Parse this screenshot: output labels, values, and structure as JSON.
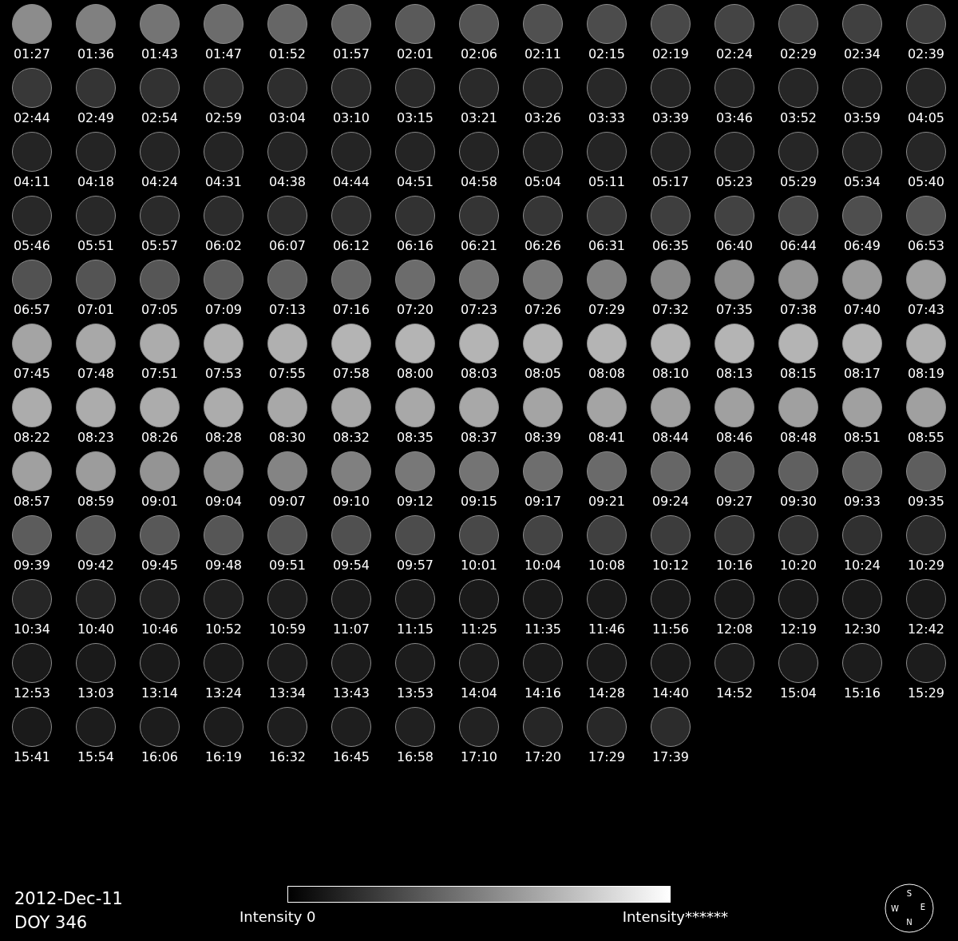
{
  "frames": [
    {
      "time": "01:27",
      "color": "#8c8c8c"
    },
    {
      "time": "01:36",
      "color": "#808080"
    },
    {
      "time": "01:43",
      "color": "#747474"
    },
    {
      "time": "01:47",
      "color": "#6c6c6c"
    },
    {
      "time": "01:52",
      "color": "#666666"
    },
    {
      "time": "01:57",
      "color": "#606060"
    },
    {
      "time": "02:01",
      "color": "#5a5a5a"
    },
    {
      "time": "02:06",
      "color": "#545454"
    },
    {
      "time": "02:11",
      "color": "#505050"
    },
    {
      "time": "02:15",
      "color": "#4c4c4c"
    },
    {
      "time": "02:19",
      "color": "#484848"
    },
    {
      "time": "02:24",
      "color": "#444444"
    },
    {
      "time": "02:29",
      "color": "#424242"
    },
    {
      "time": "02:34",
      "color": "#404040"
    },
    {
      "time": "02:39",
      "color": "#3e3e3e"
    },
    {
      "time": "02:44",
      "color": "#383838"
    },
    {
      "time": "02:49",
      "color": "#343434"
    },
    {
      "time": "02:54",
      "color": "#323232"
    },
    {
      "time": "02:59",
      "color": "#303030"
    },
    {
      "time": "03:04",
      "color": "#2e2e2e"
    },
    {
      "time": "03:10",
      "color": "#2c2c2c"
    },
    {
      "time": "03:15",
      "color": "#2a2a2a"
    },
    {
      "time": "03:21",
      "color": "#2a2a2a"
    },
    {
      "time": "03:26",
      "color": "#282828"
    },
    {
      "time": "03:33",
      "color": "#282828"
    },
    {
      "time": "03:39",
      "color": "#262626"
    },
    {
      "time": "03:46",
      "color": "#262626"
    },
    {
      "time": "03:52",
      "color": "#262626"
    },
    {
      "time": "03:59",
      "color": "#262626"
    },
    {
      "time": "04:05",
      "color": "#262626"
    },
    {
      "time": "04:11",
      "color": "#242424"
    },
    {
      "time": "04:18",
      "color": "#242424"
    },
    {
      "time": "04:24",
      "color": "#242424"
    },
    {
      "time": "04:31",
      "color": "#242424"
    },
    {
      "time": "04:38",
      "color": "#242424"
    },
    {
      "time": "04:44",
      "color": "#242424"
    },
    {
      "time": "04:51",
      "color": "#242424"
    },
    {
      "time": "04:58",
      "color": "#242424"
    },
    {
      "time": "05:04",
      "color": "#242424"
    },
    {
      "time": "05:11",
      "color": "#242424"
    },
    {
      "time": "05:17",
      "color": "#242424"
    },
    {
      "time": "05:23",
      "color": "#242424"
    },
    {
      "time": "05:29",
      "color": "#262626"
    },
    {
      "time": "05:34",
      "color": "#262626"
    },
    {
      "time": "05:40",
      "color": "#262626"
    },
    {
      "time": "05:46",
      "color": "#282828"
    },
    {
      "time": "05:51",
      "color": "#282828"
    },
    {
      "time": "05:57",
      "color": "#2a2a2a"
    },
    {
      "time": "06:02",
      "color": "#2c2c2c"
    },
    {
      "time": "06:07",
      "color": "#2e2e2e"
    },
    {
      "time": "06:12",
      "color": "#303030"
    },
    {
      "time": "06:16",
      "color": "#323232"
    },
    {
      "time": "06:21",
      "color": "#343434"
    },
    {
      "time": "06:26",
      "color": "#363636"
    },
    {
      "time": "06:31",
      "color": "#3a3a3a"
    },
    {
      "time": "06:35",
      "color": "#3e3e3e"
    },
    {
      "time": "06:40",
      "color": "#424242"
    },
    {
      "time": "06:44",
      "color": "#484848"
    },
    {
      "time": "06:49",
      "color": "#4e4e4e"
    },
    {
      "time": "06:53",
      "color": "#545454"
    },
    {
      "time": "06:57",
      "color": "#525252"
    },
    {
      "time": "07:01",
      "color": "#545454"
    },
    {
      "time": "07:05",
      "color": "#565656"
    },
    {
      "time": "07:09",
      "color": "#5c5c5c"
    },
    {
      "time": "07:13",
      "color": "#606060"
    },
    {
      "time": "07:16",
      "color": "#666666"
    },
    {
      "time": "07:20",
      "color": "#6c6c6c"
    },
    {
      "time": "07:23",
      "color": "#727272"
    },
    {
      "time": "07:26",
      "color": "#787878"
    },
    {
      "time": "07:29",
      "color": "#808080"
    },
    {
      "time": "07:32",
      "color": "#888888"
    },
    {
      "time": "07:35",
      "color": "#8e8e8e"
    },
    {
      "time": "07:38",
      "color": "#949494"
    },
    {
      "time": "07:40",
      "color": "#9a9a9a"
    },
    {
      "time": "07:43",
      "color": "#a0a0a0"
    },
    {
      "time": "07:45",
      "color": "#a4a4a4"
    },
    {
      "time": "07:48",
      "color": "#a8a8a8"
    },
    {
      "time": "07:51",
      "color": "#acacac"
    },
    {
      "time": "07:53",
      "color": "#b0b0b0"
    },
    {
      "time": "07:55",
      "color": "#b0b0b0"
    },
    {
      "time": "07:58",
      "color": "#b4b4b4"
    },
    {
      "time": "08:00",
      "color": "#b4b4b4"
    },
    {
      "time": "08:03",
      "color": "#b4b4b4"
    },
    {
      "time": "08:05",
      "color": "#b4b4b4"
    },
    {
      "time": "08:08",
      "color": "#b4b4b4"
    },
    {
      "time": "08:10",
      "color": "#b4b4b4"
    },
    {
      "time": "08:13",
      "color": "#b4b4b4"
    },
    {
      "time": "08:15",
      "color": "#b4b4b4"
    },
    {
      "time": "08:17",
      "color": "#b4b4b4"
    },
    {
      "time": "08:19",
      "color": "#b0b0b0"
    },
    {
      "time": "08:22",
      "color": "#acacac"
    },
    {
      "time": "08:23",
      "color": "#acacac"
    },
    {
      "time": "08:26",
      "color": "#acacac"
    },
    {
      "time": "08:28",
      "color": "#acacac"
    },
    {
      "time": "08:30",
      "color": "#a8a8a8"
    },
    {
      "time": "08:32",
      "color": "#a8a8a8"
    },
    {
      "time": "08:35",
      "color": "#a8a8a8"
    },
    {
      "time": "08:37",
      "color": "#a8a8a8"
    },
    {
      "time": "08:39",
      "color": "#a4a4a4"
    },
    {
      "time": "08:41",
      "color": "#a4a4a4"
    },
    {
      "time": "08:44",
      "color": "#a0a0a0"
    },
    {
      "time": "08:46",
      "color": "#a0a0a0"
    },
    {
      "time": "08:48",
      "color": "#a0a0a0"
    },
    {
      "time": "08:51",
      "color": "#a0a0a0"
    },
    {
      "time": "08:55",
      "color": "#a0a0a0"
    },
    {
      "time": "08:57",
      "color": "#a0a0a0"
    },
    {
      "time": "08:59",
      "color": "#9c9c9c"
    },
    {
      "time": "09:01",
      "color": "#949494"
    },
    {
      "time": "09:04",
      "color": "#8c8c8c"
    },
    {
      "time": "09:07",
      "color": "#848484"
    },
    {
      "time": "09:10",
      "color": "#808080"
    },
    {
      "time": "09:12",
      "color": "#787878"
    },
    {
      "time": "09:15",
      "color": "#747474"
    },
    {
      "time": "09:17",
      "color": "#6e6e6e"
    },
    {
      "time": "09:21",
      "color": "#6a6a6a"
    },
    {
      "time": "09:24",
      "color": "#666666"
    },
    {
      "time": "09:27",
      "color": "#626262"
    },
    {
      "time": "09:30",
      "color": "#606060"
    },
    {
      "time": "09:33",
      "color": "#5e5e5e"
    },
    {
      "time": "09:35",
      "color": "#5e5e5e"
    },
    {
      "time": "09:39",
      "color": "#5c5c5c"
    },
    {
      "time": "09:42",
      "color": "#5a5a5a"
    },
    {
      "time": "09:45",
      "color": "#585858"
    },
    {
      "time": "09:48",
      "color": "#565656"
    },
    {
      "time": "09:51",
      "color": "#545454"
    },
    {
      "time": "09:54",
      "color": "#505050"
    },
    {
      "time": "09:57",
      "color": "#4c4c4c"
    },
    {
      "time": "10:01",
      "color": "#484848"
    },
    {
      "time": "10:04",
      "color": "#444444"
    },
    {
      "time": "10:08",
      "color": "#404040"
    },
    {
      "time": "10:12",
      "color": "#3c3c3c"
    },
    {
      "time": "10:16",
      "color": "#383838"
    },
    {
      "time": "10:20",
      "color": "#343434"
    },
    {
      "time": "10:24",
      "color": "#303030"
    },
    {
      "time": "10:29",
      "color": "#2c2c2c"
    },
    {
      "time": "10:34",
      "color": "#262626"
    },
    {
      "time": "10:40",
      "color": "#242424"
    },
    {
      "time": "10:46",
      "color": "#222222"
    },
    {
      "time": "10:52",
      "color": "#202020"
    },
    {
      "time": "10:59",
      "color": "#1e1e1e"
    },
    {
      "time": "11:07",
      "color": "#1c1c1c"
    },
    {
      "time": "11:15",
      "color": "#1c1c1c"
    },
    {
      "time": "11:25",
      "color": "#1a1a1a"
    },
    {
      "time": "11:35",
      "color": "#1a1a1a"
    },
    {
      "time": "11:46",
      "color": "#1a1a1a"
    },
    {
      "time": "11:56",
      "color": "#1a1a1a"
    },
    {
      "time": "12:08",
      "color": "#1a1a1a"
    },
    {
      "time": "12:19",
      "color": "#1a1a1a"
    },
    {
      "time": "12:30",
      "color": "#1a1a1a"
    },
    {
      "time": "12:42",
      "color": "#1a1a1a"
    },
    {
      "time": "12:53",
      "color": "#1a1a1a"
    },
    {
      "time": "13:03",
      "color": "#1a1a1a"
    },
    {
      "time": "13:14",
      "color": "#1a1a1a"
    },
    {
      "time": "13:24",
      "color": "#1a1a1a"
    },
    {
      "time": "13:34",
      "color": "#1c1c1c"
    },
    {
      "time": "13:43",
      "color": "#1c1c1c"
    },
    {
      "time": "13:53",
      "color": "#1c1c1c"
    },
    {
      "time": "14:04",
      "color": "#1c1c1c"
    },
    {
      "time": "14:16",
      "color": "#1a1a1a"
    },
    {
      "time": "14:28",
      "color": "#1a1a1a"
    },
    {
      "time": "14:40",
      "color": "#1a1a1a"
    },
    {
      "time": "14:52",
      "color": "#1c1c1c"
    },
    {
      "time": "15:04",
      "color": "#1c1c1c"
    },
    {
      "time": "15:16",
      "color": "#1c1c1c"
    },
    {
      "time": "15:29",
      "color": "#1c1c1c"
    },
    {
      "time": "15:41",
      "color": "#1a1a1a"
    },
    {
      "time": "15:54",
      "color": "#1c1c1c"
    },
    {
      "time": "16:06",
      "color": "#1c1c1c"
    },
    {
      "time": "16:19",
      "color": "#1c1c1c"
    },
    {
      "time": "16:32",
      "color": "#1e1e1e"
    },
    {
      "time": "16:45",
      "color": "#1e1e1e"
    },
    {
      "time": "16:58",
      "color": "#202020"
    },
    {
      "time": "17:10",
      "color": "#222222"
    },
    {
      "time": "17:20",
      "color": "#262626"
    },
    {
      "time": "17:29",
      "color": "#282828"
    },
    {
      "time": "17:39",
      "color": "#2c2c2c"
    }
  ],
  "date": "2012-Dec-11",
  "doy": "DOY 346",
  "colorbar": {
    "min_label": "Intensity 0",
    "max_label": "Intensity******"
  },
  "compass": {
    "top": "S",
    "left": "W",
    "right": "E",
    "bottom": "N"
  }
}
